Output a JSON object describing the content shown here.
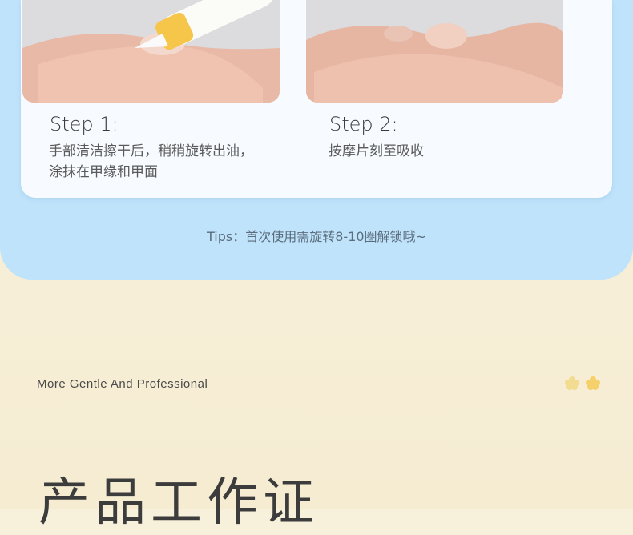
{
  "steps": [
    {
      "title": "Step 1:",
      "desc_line1": "手部清洁擦干后，稍稍旋转出油，",
      "desc_line2": "涂抹在甲缘和甲面"
    },
    {
      "title": "Step 2:",
      "desc_line1": "按摩片刻至吸收",
      "desc_line2": ""
    }
  ],
  "tips": "Tips：首次使用需旋转8-10圈解锁哦~",
  "section": {
    "subtitle": "More Gentle And Professional",
    "title": "产品工作证"
  },
  "colors": {
    "blue_bg": "#bfe3fb",
    "card_bg": "#f7fbff",
    "cream_bg": "#f7f1dc",
    "flower": "#f6d57a"
  }
}
